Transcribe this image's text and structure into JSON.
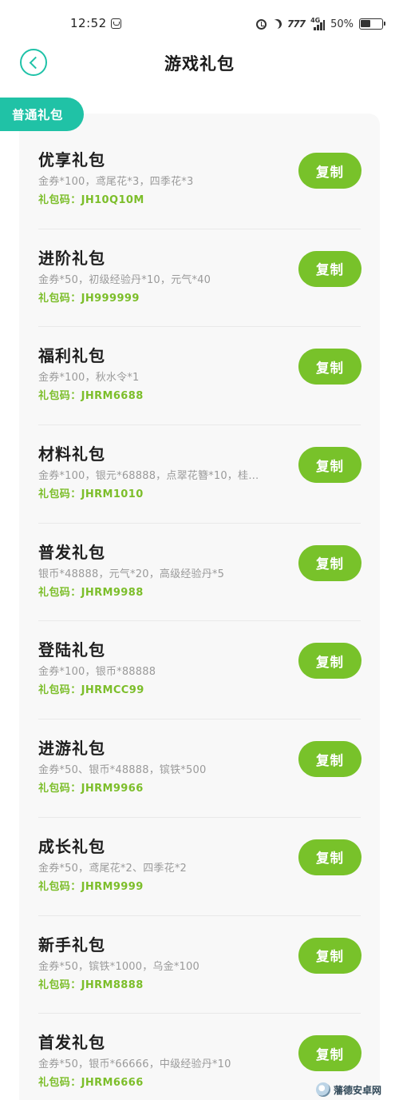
{
  "status_bar": {
    "time": "12:52",
    "speed": "7??",
    "network": "4G",
    "battery": "50%"
  },
  "header": {
    "title": "游戏礼包"
  },
  "tab": {
    "label": "普通礼包"
  },
  "gifts": [
    {
      "name": "优享礼包",
      "contents": "金券*100，鸢尾花*3，四季花*3",
      "code": "礼包码：JH10Q10M",
      "button": "复制"
    },
    {
      "name": "进阶礼包",
      "contents": "金券*50，初级经验丹*10，元气*40",
      "code": "礼包码：JH999999",
      "button": "复制"
    },
    {
      "name": "福利礼包",
      "contents": "金券*100，秋水令*1",
      "code": "礼包码：JHRM6688",
      "button": "复制"
    },
    {
      "name": "材料礼包",
      "contents": "金券*100，银元*68888，点翠花簪*10，桂花…",
      "code": "礼包码：JHRM1010",
      "button": "复制"
    },
    {
      "name": "普发礼包",
      "contents": "银币*48888，元气*20，高级经验丹*5",
      "code": "礼包码：JHRM9988",
      "button": "复制"
    },
    {
      "name": "登陆礼包",
      "contents": "金券*100，银币*88888",
      "code": "礼包码：JHRMCC99",
      "button": "复制"
    },
    {
      "name": "进游礼包",
      "contents": "金券*50、银币*48888，镔铁*500",
      "code": "礼包码：JHRM9966",
      "button": "复制"
    },
    {
      "name": "成长礼包",
      "contents": "金券*50，鸢尾花*2、四季花*2",
      "code": "礼包码：JHRM9999",
      "button": "复制"
    },
    {
      "name": "新手礼包",
      "contents": "金券*50，镔铁*1000，乌金*100",
      "code": "礼包码：JHRM8888",
      "button": "复制"
    },
    {
      "name": "首发礼包",
      "contents": "金券*50，银币*66666，中级经验丹*10",
      "code": "礼包码：JHRM6666",
      "button": "复制"
    }
  ],
  "watermark": {
    "text": "藩德安卓网"
  },
  "colors": {
    "accent_teal": "#20c2a6",
    "button_green": "#78c22a",
    "code_green": "#7cbe2a"
  }
}
